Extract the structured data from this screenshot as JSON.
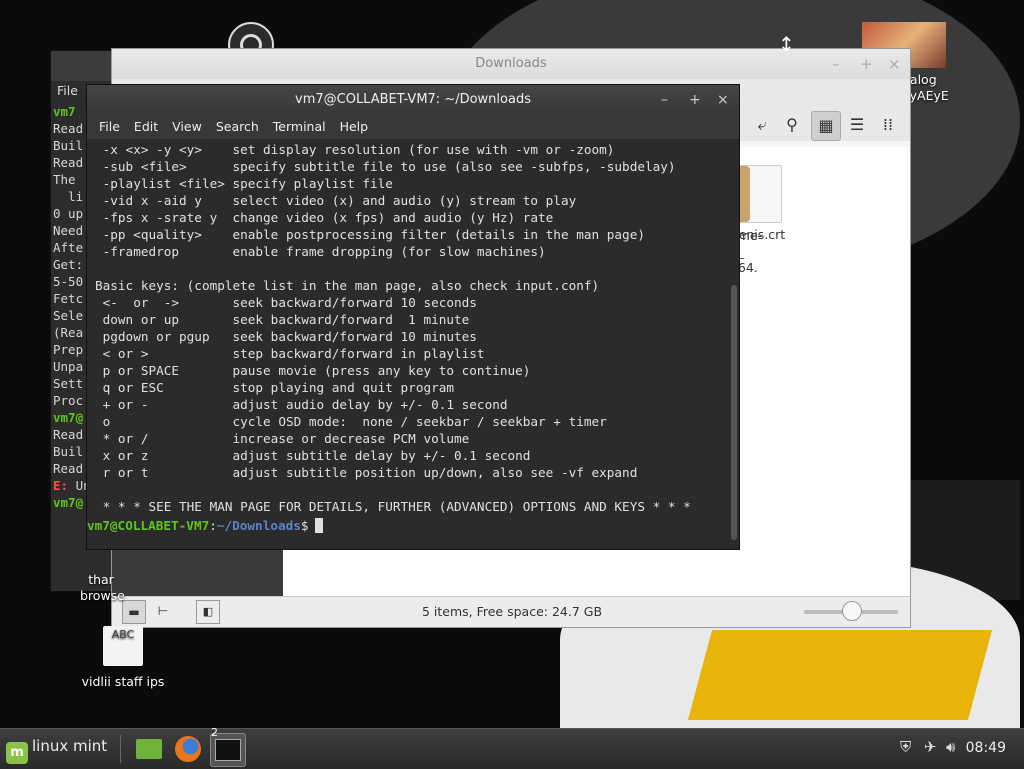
{
  "desktop": {
    "icons": [
      {
        "label": "nalog\nayAEyE",
        "icon": "photo-icon"
      },
      {
        "label": "thar\nbrowse",
        "icon": "document-icon"
      },
      {
        "label": "vidlii staff ips",
        "icon": "text-file-icon",
        "thumb": "ABC"
      }
    ]
  },
  "back_terminal": {
    "menu": "File",
    "lines": [
      [
        "g",
        "vm7"
      ],
      [
        "",
        "Read"
      ],
      [
        "",
        "Buil"
      ],
      [
        "",
        "Read"
      ],
      [
        "",
        "The "
      ],
      [
        "",
        "  li"
      ],
      [
        "",
        "0 up"
      ],
      [
        "",
        "Need"
      ],
      [
        "",
        "Afte"
      ],
      [
        "",
        "Get:"
      ],
      [
        "",
        "5-50"
      ],
      [
        "",
        "Fetc"
      ],
      [
        "",
        "Sele"
      ],
      [
        "",
        "(Rea"
      ],
      [
        "",
        "Prep"
      ],
      [
        "",
        "Unpa"
      ],
      [
        "",
        "Sett"
      ],
      [
        "",
        "Proc"
      ],
      [
        "g",
        "vm7@"
      ],
      [
        "",
        "Read"
      ],
      [
        "",
        "Buil"
      ],
      [
        "",
        "Read"
      ],
      [
        "r",
        "E: "
      ],
      [
        "g",
        "vm7@"
      ]
    ],
    "line_suffix": {
      "22": "Un"
    }
  },
  "file_manager": {
    "title": "Downloads",
    "window_buttons": [
      "–",
      "+",
      "×"
    ],
    "files": [
      {
        "name": "penis.crt",
        "icon": "certificate-file-icon"
      },
      {
        "name": "ome-\ne_\nd64.",
        "icon": "package-icon"
      }
    ],
    "status": "5 items, Free space: 24.7 GB",
    "zoom_fraction": 0.5
  },
  "terminal": {
    "title": "vm7@COLLABET-VM7: ~/Downloads",
    "window_buttons": [
      "–",
      "+",
      "×"
    ],
    "menu": [
      "File",
      "Edit",
      "View",
      "Search",
      "Terminal",
      "Help"
    ],
    "output": " -x <x> -y <y>    set display resolution (for use with -vm or -zoom)\n -sub <file>      specify subtitle file to use (also see -subfps, -subdelay)\n -playlist <file> specify playlist file\n -vid x -aid y    select video (x) and audio (y) stream to play\n -fps x -srate y  change video (x fps) and audio (y Hz) rate\n -pp <quality>    enable postprocessing filter (details in the man page)\n -framedrop       enable frame dropping (for slow machines)\n\nBasic keys: (complete list in the man page, also check input.conf)\n <-  or  ->       seek backward/forward 10 seconds\n down or up       seek backward/forward  1 minute\n pgdown or pgup   seek backward/forward 10 minutes\n < or >           step backward/forward in playlist\n p or SPACE       pause movie (press any key to continue)\n q or ESC         stop playing and quit program\n + or -           adjust audio delay by +/- 0.1 second\n o                cycle OSD mode:  none / seekbar / seekbar + timer\n * or /           increase or decrease PCM volume\n x or z           adjust subtitle delay by +/- 0.1 second\n r or t           adjust subtitle position up/down, also see -vf expand\n\n * * * SEE THE MAN PAGE FOR DETAILS, FURTHER (ADVANCED) OPTIONS AND KEYS * * *\n",
    "prompt_user": "vm7@COLLABET-VM7",
    "prompt_sep": ":",
    "prompt_path": "~/Downloads",
    "prompt_symbol": "$"
  },
  "taskbar": {
    "menu_label": "linux mint",
    "terminal_badge": "2",
    "clock": "08:49"
  }
}
